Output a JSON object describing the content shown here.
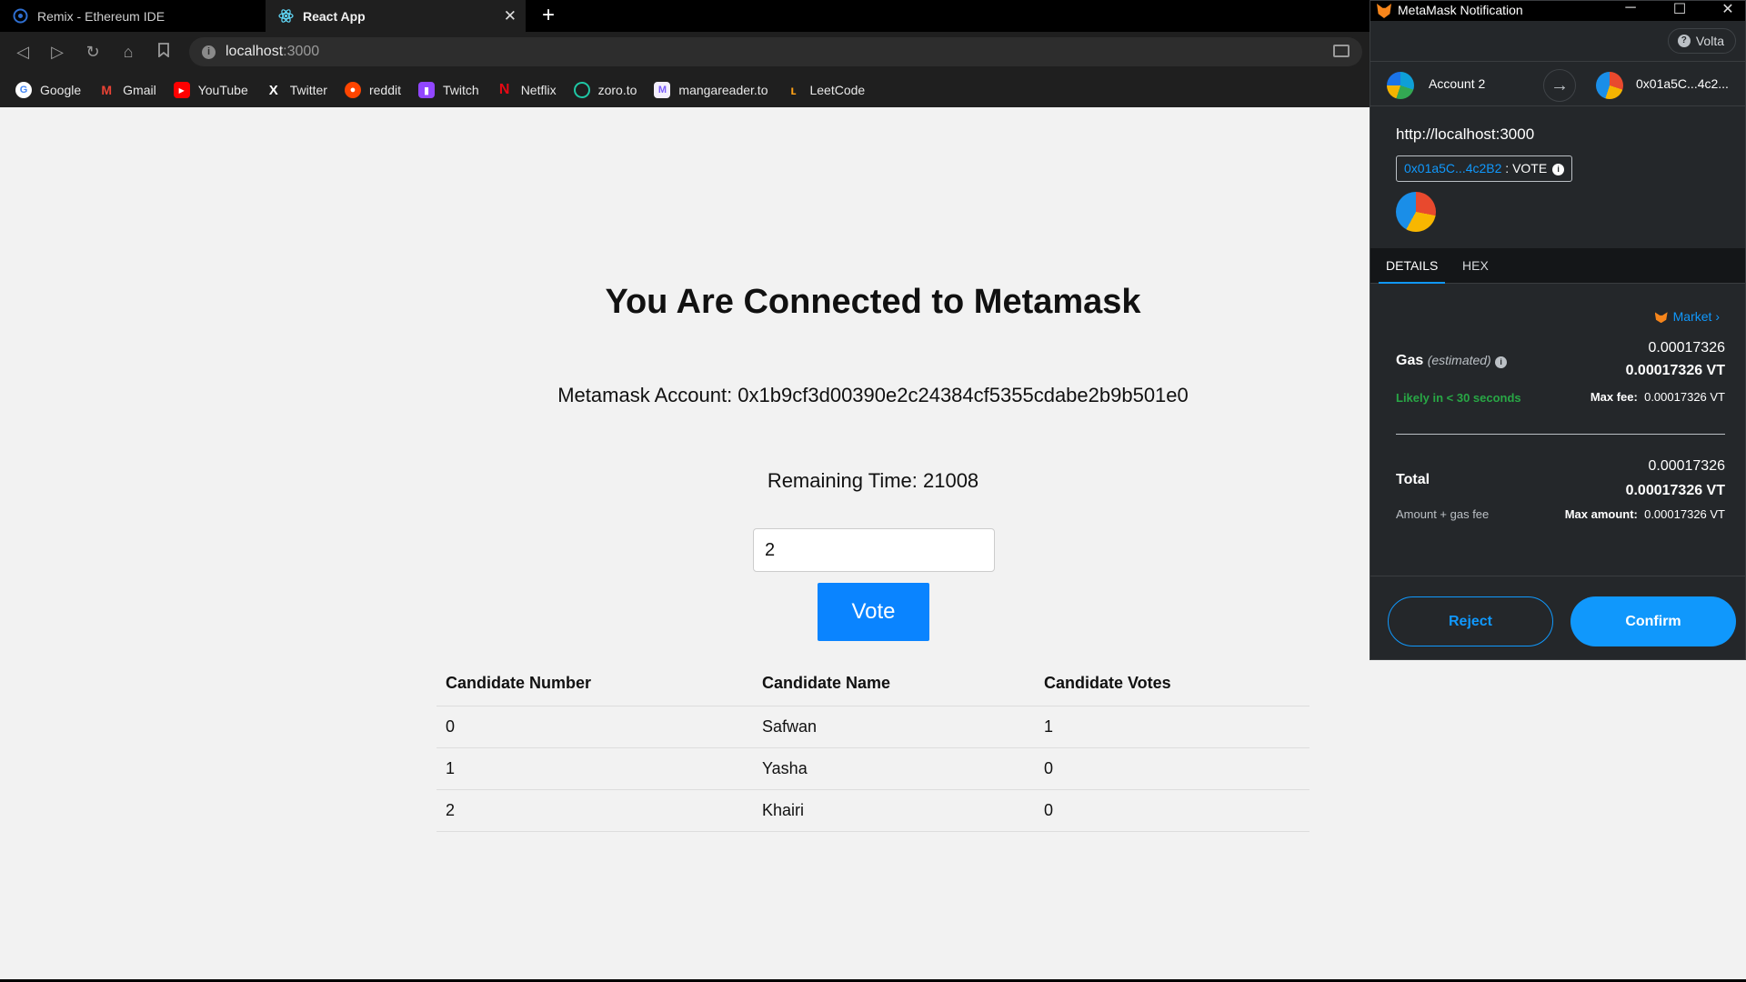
{
  "browser": {
    "tabs": [
      {
        "title": "Remix - Ethereum IDE",
        "active": false
      },
      {
        "title": "React App",
        "active": true
      }
    ],
    "url_host": "localhost",
    "url_port": ":3000",
    "bookmarks": [
      {
        "label": "Google",
        "icon": "google-icon",
        "color": "#4285f4"
      },
      {
        "label": "Gmail",
        "icon": "gmail-icon",
        "color": "#ea4335"
      },
      {
        "label": "YouTube",
        "icon": "youtube-icon",
        "color": "#ff0000"
      },
      {
        "label": "Twitter",
        "icon": "x-icon",
        "color": "#ffffff"
      },
      {
        "label": "reddit",
        "icon": "reddit-icon",
        "color": "#ff4500"
      },
      {
        "label": "Twitch",
        "icon": "twitch-icon",
        "color": "#9146ff"
      },
      {
        "label": "Netflix",
        "icon": "netflix-icon",
        "color": "#e50914"
      },
      {
        "label": "zoro.to",
        "icon": "zoro-icon",
        "color": "#1fc7a5"
      },
      {
        "label": "mangareader.to",
        "icon": "mangareader-icon",
        "color": "#7a5cfa"
      },
      {
        "label": "LeetCode",
        "icon": "leetcode-icon",
        "color": "#ffa116"
      }
    ]
  },
  "app": {
    "title": "You Are Connected to Metamask",
    "account_line": "Metamask Account: 0x1b9cf3d00390e2c24384cf5355cdabe2b9b501e0",
    "remaining_line": "Remaining Time: 21008",
    "vote_input_value": "2",
    "vote_button": "Vote",
    "table": {
      "headers": [
        "Candidate Number",
        "Candidate Name",
        "Candidate Votes"
      ],
      "rows": [
        [
          "0",
          "Safwan",
          "1"
        ],
        [
          "1",
          "Yasha",
          "0"
        ],
        [
          "2",
          "Khairi",
          "0"
        ]
      ]
    }
  },
  "metamask": {
    "window_title": "MetaMask Notification",
    "network": "Volta",
    "from_account": "Account 2",
    "to_account": "0x01a5C...4c2...",
    "origin": "http://localhost:3000",
    "contract_address": "0x01a5C...4c2B2",
    "contract_method": ": VOTE",
    "tabs": [
      "DETAILS",
      "HEX"
    ],
    "market_label": "Market",
    "gas_label": "Gas",
    "gas_estimated": "(estimated)",
    "gas_value": "0.00017326",
    "gas_value_vt": "0.00017326 VT",
    "likely": "Likely in < 30 seconds",
    "max_fee_label": "Max fee:",
    "max_fee_value": "0.00017326 VT",
    "total_label": "Total",
    "total_value": "0.00017326",
    "total_value_vt": "0.00017326 VT",
    "amount_gas_label": "Amount + gas fee",
    "max_amount_label": "Max amount:",
    "max_amount_value": "0.00017326 VT",
    "reject": "Reject",
    "confirm": "Confirm"
  }
}
